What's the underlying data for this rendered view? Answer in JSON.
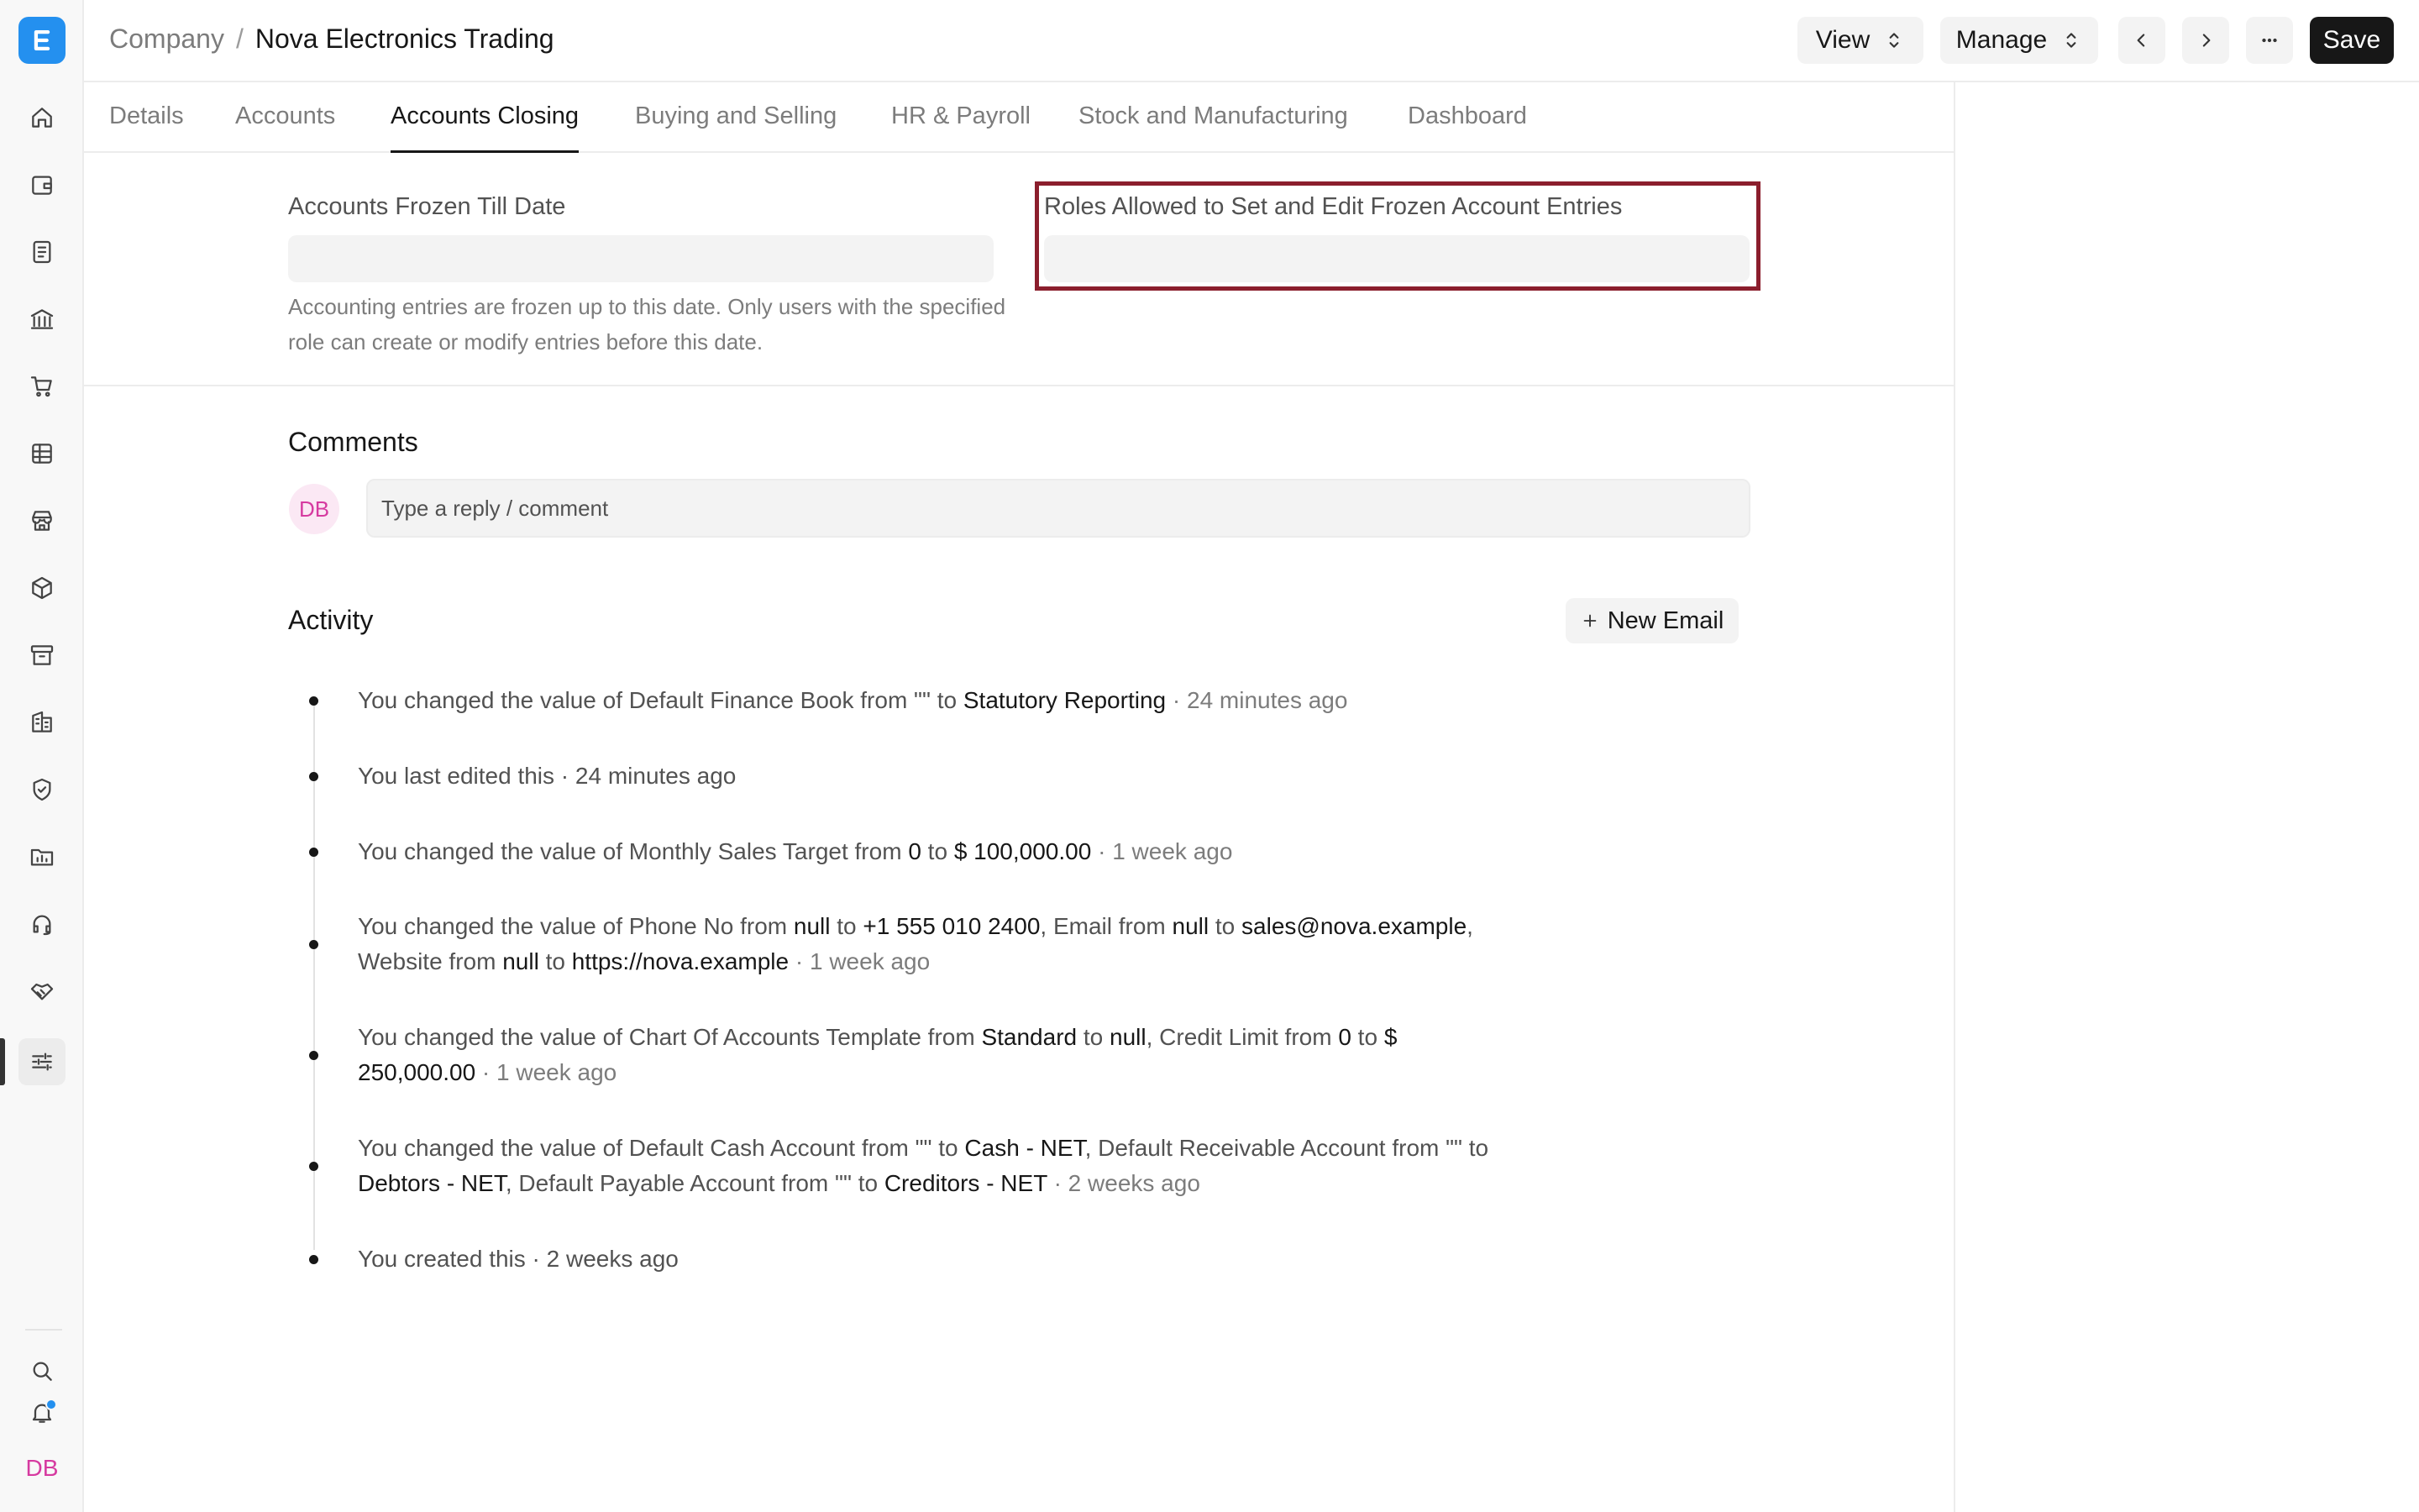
{
  "sidebar": {
    "logo_letter": "E",
    "items": [
      {
        "icon": "home-icon"
      },
      {
        "icon": "wallet-icon"
      },
      {
        "icon": "document-icon"
      },
      {
        "icon": "bank-icon"
      },
      {
        "icon": "cart-icon"
      },
      {
        "icon": "table-icon"
      },
      {
        "icon": "store-icon"
      },
      {
        "icon": "package-icon"
      },
      {
        "icon": "archive-icon"
      },
      {
        "icon": "building-icon"
      },
      {
        "icon": "shield-icon"
      },
      {
        "icon": "folder-chart-icon"
      },
      {
        "icon": "headset-icon"
      },
      {
        "icon": "handshake-icon"
      },
      {
        "icon": "sliders-icon",
        "active": true
      }
    ],
    "user_initials": "DB"
  },
  "header": {
    "breadcrumb_parent": "Company",
    "breadcrumb_sep": "/",
    "title": "Nova Electronics Trading",
    "view_label": "View",
    "manage_label": "Manage",
    "more_label": "···",
    "save_label": "Save"
  },
  "tabs": [
    {
      "label": "Details"
    },
    {
      "label": "Accounts"
    },
    {
      "label": "Accounts Closing",
      "active": true
    },
    {
      "label": "Buying and Selling"
    },
    {
      "label": "HR & Payroll"
    },
    {
      "label": "Stock and Manufacturing"
    },
    {
      "label": "Dashboard"
    }
  ],
  "form": {
    "frozen_till_label": "Accounts Frozen Till Date",
    "frozen_till_value": "",
    "frozen_till_desc": "Accounting entries are frozen up to this date. Only users with the specified role can create or modify entries before this date.",
    "roles_label": "Roles Allowed to Set and Edit Frozen Account Entries",
    "roles_value": ""
  },
  "comments": {
    "title": "Comments",
    "avatar": "DB",
    "placeholder": "Type a reply / comment"
  },
  "activity": {
    "title": "Activity",
    "new_email_label": "New Email",
    "entries": [
      {
        "parts": [
          [
            "You changed the value of Default Finance Book from \"\" to ",
            0
          ],
          [
            "Statutory Reporting",
            1
          ],
          [
            " · 24 minutes ago",
            2
          ]
        ]
      },
      {
        "parts": [
          [
            "You last edited this · 24 minutes ago",
            0
          ]
        ]
      },
      {
        "parts": [
          [
            "You changed the value of Monthly Sales Target from ",
            0
          ],
          [
            "0",
            1
          ],
          [
            " to ",
            0
          ],
          [
            "$ 100,000.00",
            1
          ],
          [
            " · 1 week ago",
            2
          ]
        ]
      },
      {
        "parts": [
          [
            "You changed the value of Phone No from ",
            0
          ],
          [
            "null",
            1
          ],
          [
            " to ",
            0
          ],
          [
            "+1 555 010 2400",
            1
          ],
          [
            ", Email from ",
            0
          ],
          [
            "null",
            1
          ],
          [
            " to ",
            0
          ],
          [
            "sales@nova.example",
            1
          ],
          [
            ", Website from ",
            0
          ],
          [
            "null",
            1
          ],
          [
            " to ",
            0
          ],
          [
            "https://nova.example",
            1
          ],
          [
            " · 1 week ago",
            2
          ]
        ]
      },
      {
        "parts": [
          [
            "You changed the value of Chart Of Accounts Template from ",
            0
          ],
          [
            "Standard",
            1
          ],
          [
            " to ",
            0
          ],
          [
            "null",
            1
          ],
          [
            ", Credit Limit from ",
            0
          ],
          [
            "0",
            1
          ],
          [
            " to ",
            0
          ],
          [
            "$ 250,000.00",
            1
          ],
          [
            " · 1 week ago",
            2
          ]
        ]
      },
      {
        "parts": [
          [
            "You changed the value of Default Cash Account from \"\" to ",
            0
          ],
          [
            "Cash - NET",
            1
          ],
          [
            ", Default Receivable Account from \"\" to ",
            0
          ],
          [
            "Debtors - NET",
            1
          ],
          [
            ", Default Payable Account from \"\" to ",
            0
          ],
          [
            "Creditors - NET",
            1
          ],
          [
            " · 2 weeks ago",
            2
          ]
        ]
      },
      {
        "parts": [
          [
            "You created this · 2 weeks ago",
            0
          ]
        ]
      }
    ]
  },
  "colors": {
    "brand": "#2490ef",
    "highlight_border": "#8b1e2d",
    "avatar_pink": "#d63aa0"
  }
}
